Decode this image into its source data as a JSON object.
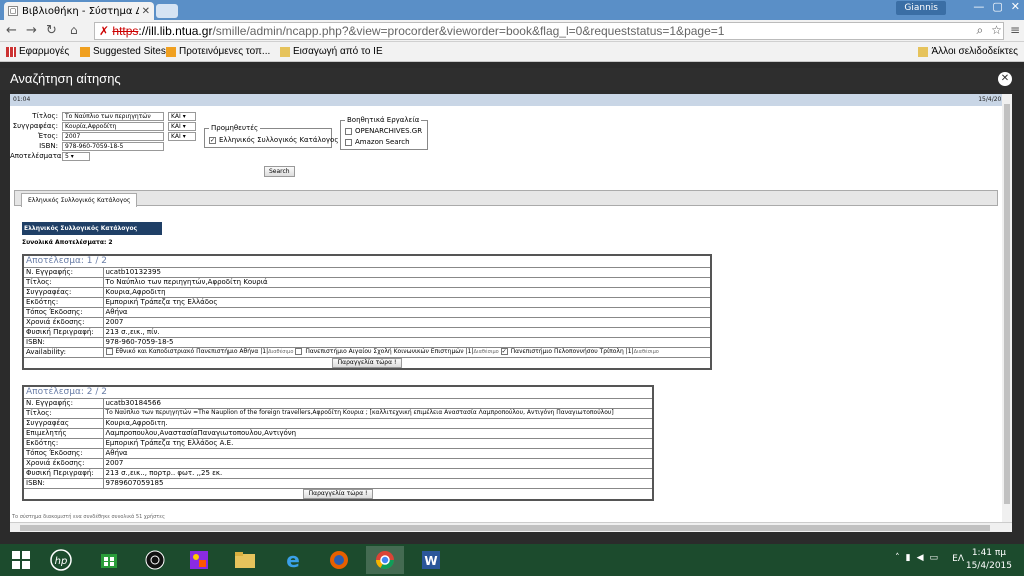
{
  "browser": {
    "tab_title": "Βιβλιοθήκη - Σύστημα Δια",
    "user": "Giannis",
    "url_bad": "https",
    "url_host": "://ill.lib.ntua.gr",
    "url_path": "/smille/admin/ncapp.php?&view=procorder&vieworder=book&flag_l=0&requeststatus=1&page=1",
    "bookmarks": [
      "Εφαρμογές",
      "Suggested Sites",
      "Προτεινόμενες τοπ...",
      "Εισαγωγή από το IE",
      "Άλλοι σελιδοδείκτες"
    ]
  },
  "modal": {
    "title": "Αναζήτηση αίτησης"
  },
  "strip": {
    "left": "01:04",
    "right": "15/4/2015"
  },
  "form": {
    "title_label": "Τίτλος:",
    "title_value": "Το Ναύπλιο των περιηγητών",
    "author_label": "Συγγραφέας:",
    "author_value": "Κουρία,Αφροδίτη",
    "year_label": "Έτος:",
    "year_value": "2007",
    "isbn_label": "ISBN:",
    "isbn_value": "978-960-7059-18-5",
    "results_label": "Αποτελέσματα:",
    "results_value": "5",
    "op1": "ΚΑΙ",
    "op2": "ΚΑΙ",
    "op3": "ΚΑΙ",
    "providers_legend": "Προμηθευτές",
    "provider1": "Ελληνικός Συλλογικός Κατάλογος",
    "tools_legend": "Βοηθητικά Εργαλεία",
    "tool1": "OPENARCHIVES.GR",
    "tool2": "Amazon Search",
    "search_button": "Search"
  },
  "tabs": {
    "active": "Ελληνικός Συλλογικός Κατάλογος"
  },
  "results": {
    "catalog_title": "Ελληνικός Συλλογικός Κατάλογος",
    "total": "Συνολικά Αποτελέσματα: 2",
    "r1": {
      "header": "Αποτέλεσμα: 1 / 2",
      "rows": [
        [
          "Ν. Εγγραφής:",
          "ucatb10132395"
        ],
        [
          "Τίτλος:",
          "Το Ναύπλιο των περιηγητών,Αφροδίτη Κουριά"
        ],
        [
          "Συγγραφέας:",
          "Κουρια,Αφροδιτη"
        ],
        [
          "Εκδότης:",
          "Εμπορική Τράπεζα της Ελλάδος"
        ],
        [
          "Τόπος Έκδοσης:",
          "Αθήνα"
        ],
        [
          "Χρονιά έκδοσης:",
          "2007"
        ],
        [
          "Φυσική Περιγραφή:",
          "213 σ.,εικ., πίν."
        ],
        [
          "ISBN:",
          "978-960-7059-18-5"
        ]
      ],
      "availability_label": "Availability:",
      "avail": [
        {
          "name": "Εθνικό και Καποδιστριακό Πανεπιστήμιο Αθήνα",
          "count": "|1|",
          "status": "Διαθέσιμο",
          "checked": ""
        },
        {
          "name": "Πανεπιστήμιο Αιγαίου Σχολή Κοινωνικών Επιστημών",
          "count": "|1|",
          "status": "Διαθέσιμο",
          "checked": ""
        },
        {
          "name": "Πανεπιστήμιο Πελοποννήσου Τρίπολη",
          "count": "|1|",
          "status": "Διαθέσιμο",
          "checked": "✓"
        }
      ],
      "order_button": "Παραγγελία τώρα !"
    },
    "r2": {
      "header": "Αποτέλεσμα: 2 / 2",
      "rows": [
        [
          "Ν. Εγγραφής:",
          "ucatb30184566"
        ],
        [
          "Τίτλος:",
          "Το Ναύπλιο των περιηγητών =The Nauplion of the foreign travellers,Αφροδίτη Κουρια ; [καλλιτεχνική επιμέλεια Αναστασία Λαμπροπούλου, Αντιγόνη Παναγιωτοπούλου]"
        ],
        [
          "Συγγραφέας",
          "Κουρια,Αφροδιτη."
        ],
        [
          "Επιμελητής",
          "Λαμπροπουλου,ΑναστασίαΠαναγιωτοπουλου,Αντιγόνη"
        ],
        [
          "Εκδότης:",
          "Εμπορική Τράπεζα της Ελλάδος Α.Ε."
        ],
        [
          "Τόπος Έκδοσης:",
          "Αθήνα"
        ],
        [
          "Χρονιά έκδοσης:",
          "2007"
        ],
        [
          "Φυσική Περιγραφή:",
          "213 σ.,εικ.., πορτρ.. φωτ. ,,25 εκ."
        ],
        [
          "ISBN:",
          "9789607059185"
        ]
      ],
      "order_button": "Παραγγελία τώρα !"
    },
    "footer_note": "Το σύστημα διακομιστή ενα συνδέθηκε συνολικά 51 χρήστες"
  },
  "taskbar": {
    "lang": "ΕΛ",
    "time": "1:41 πμ",
    "date": "15/4/2015"
  }
}
